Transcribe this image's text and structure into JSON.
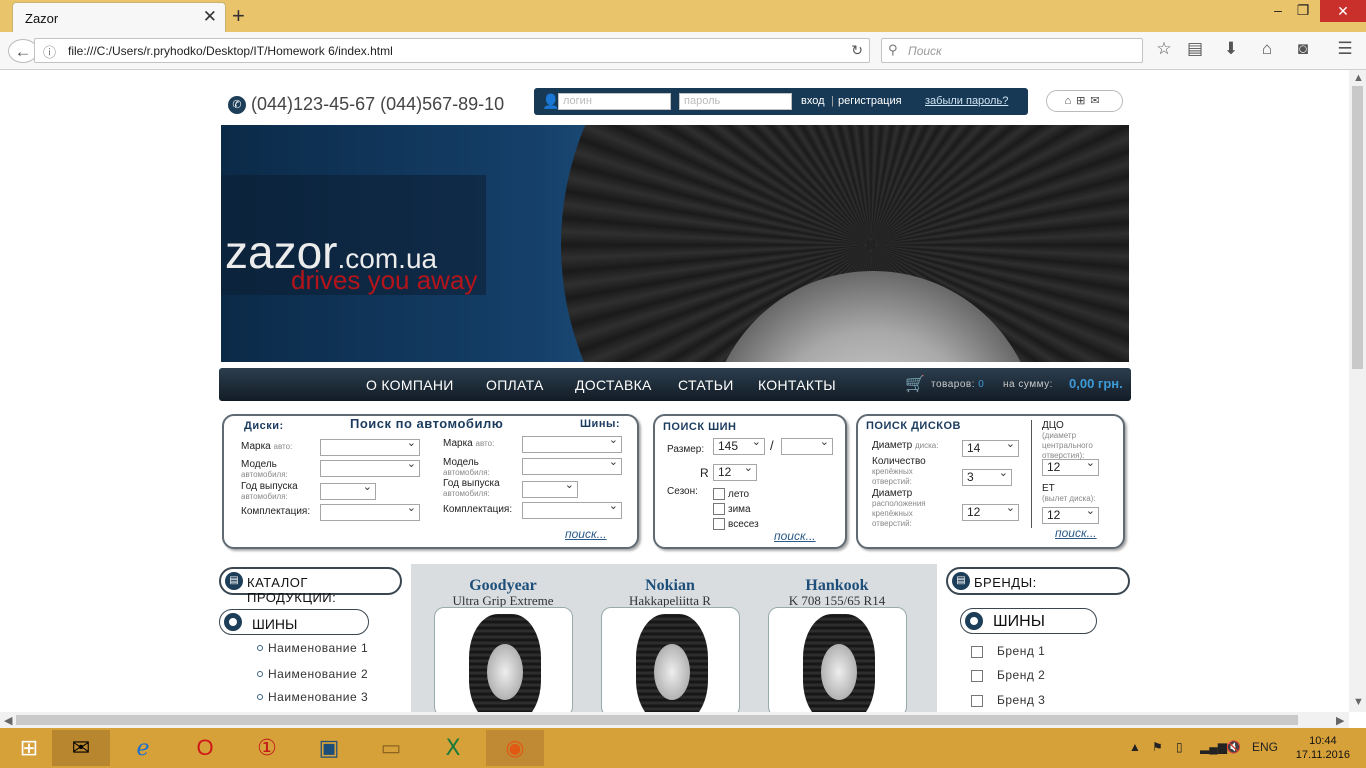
{
  "browser": {
    "tab_title": "Zazor",
    "url": "file:///C:/Users/r.pryhodko/Desktop/IT/Homework 6/index.html",
    "search_placeholder": "Поиск"
  },
  "header": {
    "phone": "(044)123-45-67 (044)567-89-10",
    "login_placeholder": "логин",
    "password_placeholder": "пароль",
    "enter_link": "вход",
    "separator": "|",
    "register_link": "регистрация",
    "forgot_link": "забыли пароль?"
  },
  "banner": {
    "logo_main": "zazor",
    "logo_domain": ".com.ua",
    "tagline": "drives you away"
  },
  "menu": {
    "items": [
      "О КОМПАНИ",
      "ОПЛАТА",
      "ДОСТАВКА",
      "СТАТЬИ",
      "КОНТАКТЫ"
    ],
    "cart_items_label": "товаров:",
    "cart_items_value": "0",
    "cart_sum_label": "на сумму:",
    "cart_sum_value": "0,00 грн."
  },
  "car_search": {
    "title": "Поиск по автомобилю",
    "disks_title": "Диски:",
    "tyres_title": "Шины:",
    "brand_label": "Марка",
    "brand_sub": "авто:",
    "model_label": "Модель",
    "model_sub": "автомобиля:",
    "year_label": "Год выпуска",
    "year_sub": "автомобиля:",
    "config_label": "Комплектация:",
    "find": "поиск..."
  },
  "tyre_search": {
    "title": "ПОИСК ШИН",
    "size_label": "Размер:",
    "size_value": "145",
    "slash": "/",
    "r_label": "R",
    "r_value": "12",
    "season_label": "Сезон:",
    "seasons": [
      "лето",
      "зима",
      "всесез"
    ],
    "find": "поиск..."
  },
  "disk_search": {
    "title": "ПОИСК ДИСКОВ",
    "diameter_label": "Диаметр",
    "diameter_sub": "диска:",
    "diameter_value": "14",
    "count_label": "Количество",
    "count_sub": "крепёжных отверстий:",
    "count_value": "3",
    "pcd_label": "Диаметр",
    "pcd_sub": "расположения крепёжных отверстий:",
    "pcd_value": "12",
    "dco_label": "ДЦО",
    "dco_sub": "(диаметр центрального отверстия):",
    "dco_value": "12",
    "et_label": "ET",
    "et_sub": "(вылет диска):",
    "et_value": "12",
    "find": "поиск..."
  },
  "catalog": {
    "title": "КАТАЛОГ ПРОДУКЦИИ:",
    "section": "ШИНЫ",
    "items": [
      "Наименование 1",
      "Наименование 2",
      "Наименование 3"
    ]
  },
  "products": [
    {
      "brand": "Goodyear",
      "name": "Ultra Grip Extreme"
    },
    {
      "brand": "Nokian",
      "name": "Hakkapeliitta R"
    },
    {
      "brand": "Hankook",
      "name": "K 708 155/65 R14"
    }
  ],
  "brands": {
    "title": "БРЕНДЫ:",
    "section": "ШИНЫ",
    "items": [
      "Бренд 1",
      "Бренд 2",
      "Бренд 3"
    ]
  },
  "taskbar": {
    "lang": "ENG",
    "time": "10:44",
    "date": "17.11.2016"
  }
}
